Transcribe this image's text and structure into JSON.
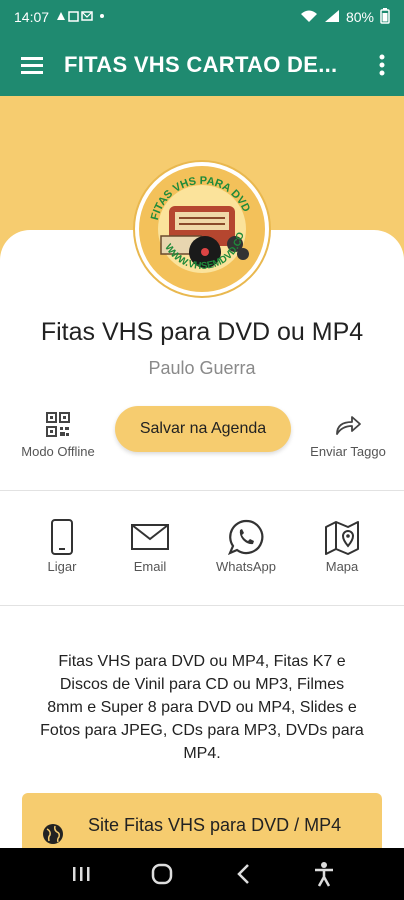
{
  "status_bar": {
    "time": "14:07",
    "battery": "80%"
  },
  "app_bar": {
    "title": "FITAS VHS CARTAO DE..."
  },
  "logo": {
    "text_top": "FITAS VHS PARA DVD",
    "text_bottom": "WWW.VHSEMDVD.COM"
  },
  "profile": {
    "title": "Fitas VHS para DVD ou MP4",
    "subtitle": "Paulo Guerra"
  },
  "actions": {
    "offline_label": "Modo Offline",
    "save_label": "Salvar na Agenda",
    "share_label": "Enviar Taggo"
  },
  "contacts": [
    {
      "label": "Ligar",
      "icon": "phone-icon"
    },
    {
      "label": "Email",
      "icon": "mail-icon"
    },
    {
      "label": "WhatsApp",
      "icon": "whatsapp-icon"
    },
    {
      "label": "Mapa",
      "icon": "map-icon"
    }
  ],
  "description": "Fitas VHS para DVD ou MP4, Fitas K7 e Discos de Vinil para CD ou MP3, Filmes 8mm e Super 8 para DVD ou MP4, Slides e Fotos para JPEG, CDs para MP3, DVDs para MP4.",
  "site_link": {
    "label": "Site Fitas VHS para DVD / MP4"
  },
  "colors": {
    "header_green": "#1f8a70",
    "accent_yellow": "#f6cc6f"
  }
}
